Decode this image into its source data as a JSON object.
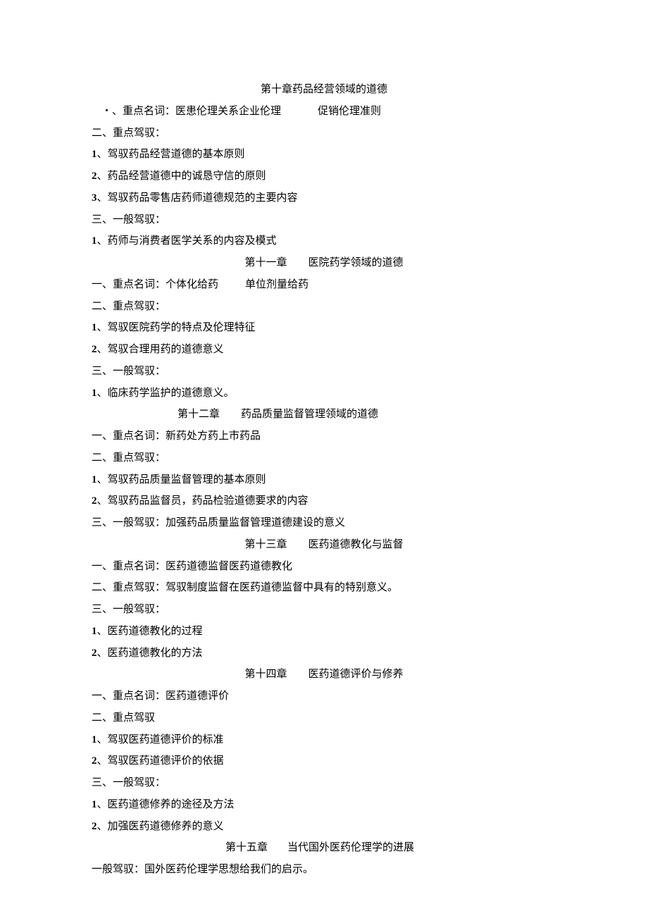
{
  "ch10": {
    "title": "第十章药品经营领域的道德",
    "line1_a": "・、重点名词：医患伦理关系企业伦理",
    "line1_b": "促销伦理准则",
    "s2_header": "二、重点驾驭：",
    "s2_1_num": "1",
    "s2_1": "、驾驭药品经营道德的基本原则",
    "s2_2_num": "2",
    "s2_2": "、药品经营道德中的诚恳守信的原则",
    "s2_3_num": "3",
    "s2_3": "、驾驭药品零售店药师道德规范的主要内容",
    "s3_header": "三、一般驾驭：",
    "s3_1_num": "1",
    "s3_1": "、药师与消费者医学关系的内容及模式"
  },
  "ch11": {
    "title_a": "第十一章",
    "title_b": "医院药学领域的道德",
    "s1_a": "一、重点名词：个体化给药",
    "s1_b": "单位剂量给药",
    "s2_header": "二、重点驾驭：",
    "s2_1_num": "1",
    "s2_1": "、驾驭医院药学的特点及伦理特征",
    "s2_2_num": "2",
    "s2_2": "、驾驭合理用药的道德意义",
    "s3_header": "三、一般驾驭：",
    "s3_1_num": "1",
    "s3_1": "、临床药学监护的道德意义。"
  },
  "ch12": {
    "title_a": "第十二章",
    "title_b": "药品质量监督管理领域的道德",
    "s1": "一、重点名词：新药处方药上市药品",
    "s2_header": "二、重点驾驭：",
    "s2_1_num": "1",
    "s2_1": "、驾驭药品质量监督管理的基本原则",
    "s2_2_num": "2",
    "s2_2": "、驾驭药品监督员，药品检验道德要求的内容",
    "s3": "三、一般驾驭：加强药品质量监督管理道德建设的意义"
  },
  "ch13": {
    "title_a": "第十三章",
    "title_b": "医药道德教化与监督",
    "s1": "一、重点名词：医药道德监督医药道德教化",
    "s2": "二、重点驾驭：驾驭制度监督在医药道德监督中具有的特别意义。",
    "s3_header": "三、一般驾驭：",
    "s3_1_num": "1",
    "s3_1": "、医药道德教化的过程",
    "s3_2_num": "2",
    "s3_2": "、医药道德教化的方法"
  },
  "ch14": {
    "title_a": "第十四章",
    "title_b": "医药道德评价与修养",
    "s1": "一、重点名词：医药道德评价",
    "s2_header": "二、重点驾驭",
    "s2_1_num": "1",
    "s2_1": "、驾驭医药道德评价的标准",
    "s2_2_num": "2",
    "s2_2": "、驾驭医药道德评价的依据",
    "s3_header": "三、一般驾驭：",
    "s3_1_num": "1",
    "s3_1": "、医药道德修养的途径及方法",
    "s3_2_num": "2",
    "s3_2": "、加强医药道德修养的意义"
  },
  "ch15": {
    "title_a": "第十五章",
    "title_b": "当代国外医药伦理学的进展",
    "s1": "一般驾驭：国外医药伦理学思想给我们的启示。"
  }
}
